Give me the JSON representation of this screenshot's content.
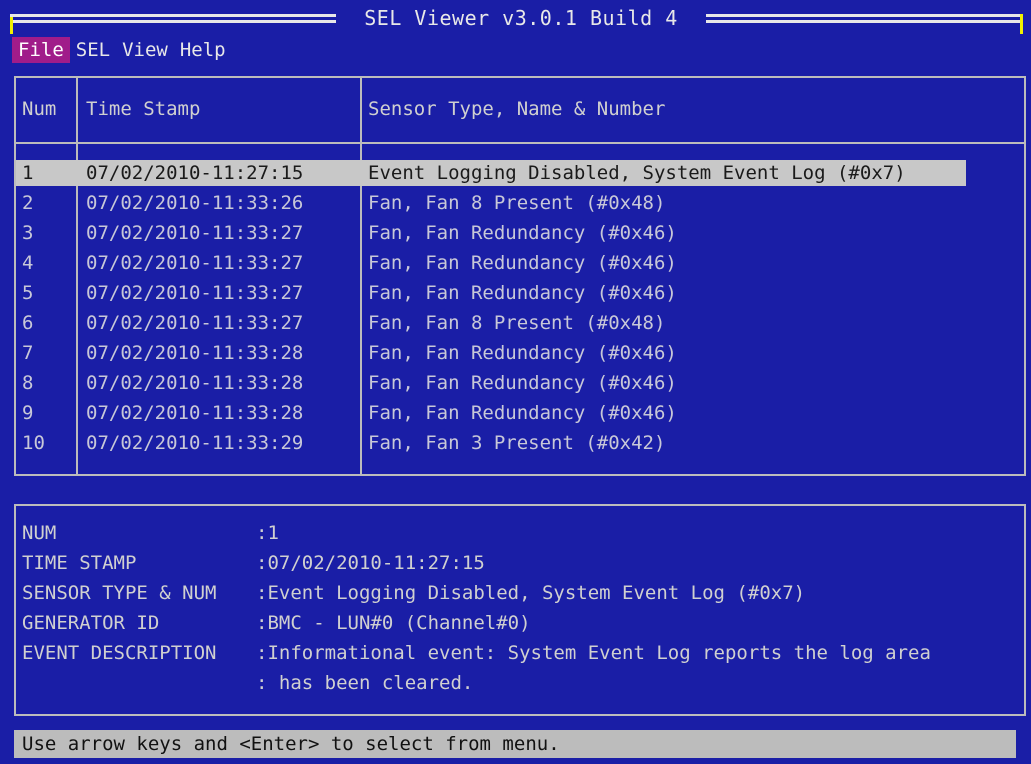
{
  "window": {
    "title": "SEL Viewer v3.0.1 Build 4"
  },
  "menu": {
    "items": [
      "File",
      "SEL",
      "View",
      "Help"
    ],
    "active": "File"
  },
  "table": {
    "headers": [
      "Num",
      "Time Stamp",
      "Sensor Type, Name & Number"
    ],
    "rows": [
      {
        "num": "1",
        "time": "07/02/2010-11:27:15",
        "sensor": "Event Logging Disabled, System Event Log (#0x7)"
      },
      {
        "num": "2",
        "time": "07/02/2010-11:33:26",
        "sensor": "Fan, Fan 8 Present (#0x48)"
      },
      {
        "num": "3",
        "time": "07/02/2010-11:33:27",
        "sensor": "Fan, Fan Redundancy (#0x46)"
      },
      {
        "num": "4",
        "time": "07/02/2010-11:33:27",
        "sensor": "Fan, Fan Redundancy (#0x46)"
      },
      {
        "num": "5",
        "time": "07/02/2010-11:33:27",
        "sensor": "Fan, Fan Redundancy (#0x46)"
      },
      {
        "num": "6",
        "time": "07/02/2010-11:33:27",
        "sensor": "Fan, Fan 8 Present (#0x48)"
      },
      {
        "num": "7",
        "time": "07/02/2010-11:33:28",
        "sensor": "Fan, Fan Redundancy (#0x46)"
      },
      {
        "num": "8",
        "time": "07/02/2010-11:33:28",
        "sensor": "Fan, Fan Redundancy (#0x46)"
      },
      {
        "num": "9",
        "time": "07/02/2010-11:33:28",
        "sensor": "Fan, Fan Redundancy (#0x46)"
      },
      {
        "num": "10",
        "time": "07/02/2010-11:33:29",
        "sensor": "Fan, Fan 3 Present (#0x42)"
      }
    ],
    "selected_index": 0
  },
  "detail": {
    "num_label": "NUM",
    "num_value": ":1",
    "time_label": "TIME STAMP",
    "time_value": ":07/02/2010-11:27:15",
    "sensor_label": "SENSOR TYPE & NUM",
    "sensor_value": ":Event Logging Disabled, System Event Log (#0x7)",
    "generator_label": "GENERATOR ID",
    "generator_value": ":BMC - LUN#0 (Channel#0)",
    "event_label": "EVENT DESCRIPTION",
    "event_value_line1": ":Informational event: System Event Log reports the log area",
    "event_value_line2": ": has been cleared."
  },
  "status": {
    "text": "Use arrow keys and <Enter> to select from menu."
  },
  "colors": {
    "background": "#1a1ea6",
    "selection": "#c8c8c8",
    "menu_active": "#a01c8a",
    "title_accent": "#f0f000"
  }
}
